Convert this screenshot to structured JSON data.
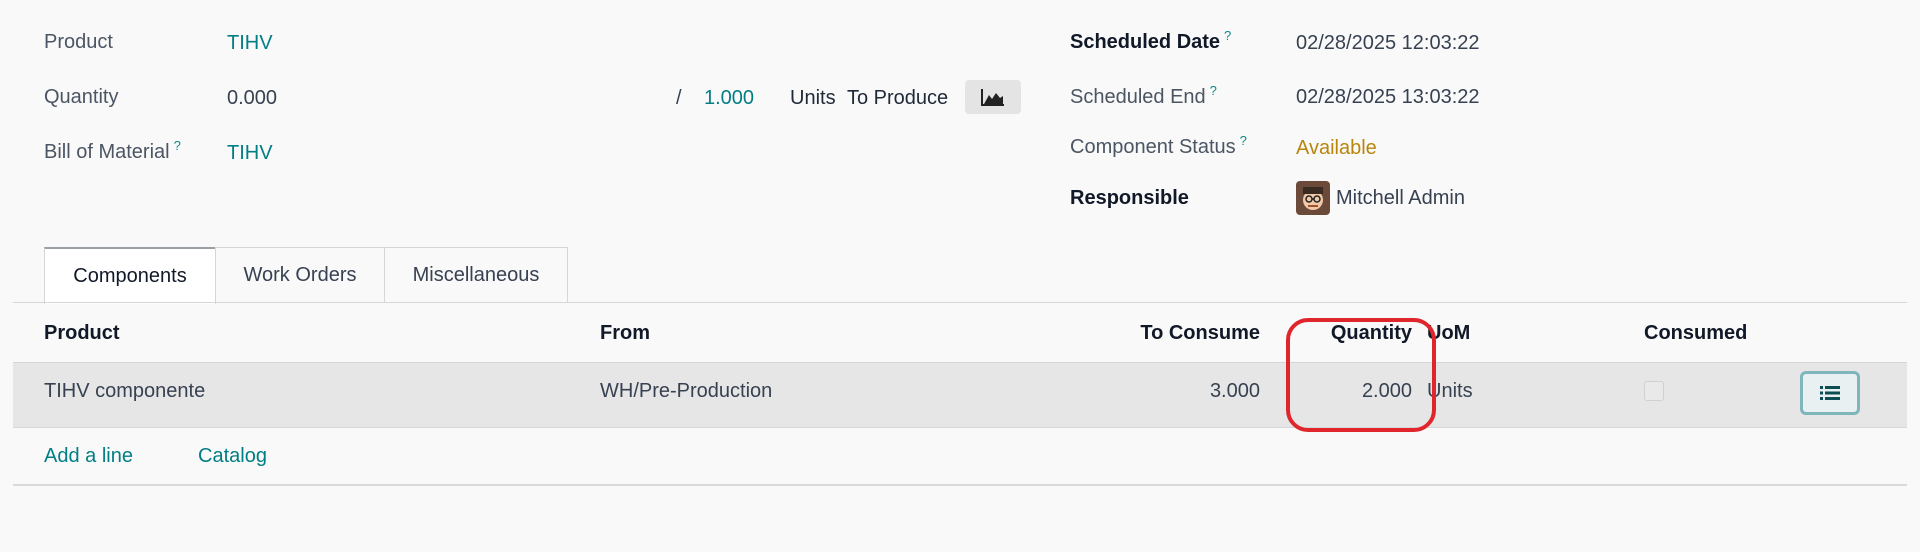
{
  "form": {
    "product_label": "Product",
    "product_value": "TIHV",
    "quantity_label": "Quantity",
    "quantity_value": "0.000",
    "slash": "/",
    "quantity_target": "1.000",
    "units_label": "Units",
    "to_produce_label": "To Produce",
    "bom_label": "Bill of Material",
    "bom_help": "?",
    "bom_value": "TIHV",
    "scheduled_date_label": "Scheduled Date",
    "scheduled_date_help": "?",
    "scheduled_date_value": "02/28/2025 12:03:22",
    "scheduled_end_label": "Scheduled End",
    "scheduled_end_help": "?",
    "scheduled_end_value": "02/28/2025 13:03:22",
    "component_status_label": "Component Status",
    "component_status_help": "?",
    "component_status_value": "Available",
    "responsible_label": "Responsible",
    "responsible_value": "Mitchell Admin"
  },
  "tabs": [
    {
      "label": "Components"
    },
    {
      "label": "Work Orders"
    },
    {
      "label": "Miscellaneous"
    }
  ],
  "table": {
    "headers": {
      "product": "Product",
      "from": "From",
      "to_consume": "To Consume",
      "quantity": "Quantity",
      "uom": "UoM",
      "consumed": "Consumed"
    },
    "rows": [
      {
        "product": "TIHV componente",
        "from": "WH/Pre-Production",
        "to_consume": "3.000",
        "quantity": "2.000",
        "uom": "Units",
        "consumed": false
      }
    ],
    "add_line": "Add a line",
    "catalog": "Catalog"
  },
  "colors": {
    "link": "#017e84",
    "status_available": "#b8860b",
    "annotation": "#e0262d"
  },
  "icons": {
    "forecast": "area-chart-icon",
    "detail": "list-icon"
  }
}
